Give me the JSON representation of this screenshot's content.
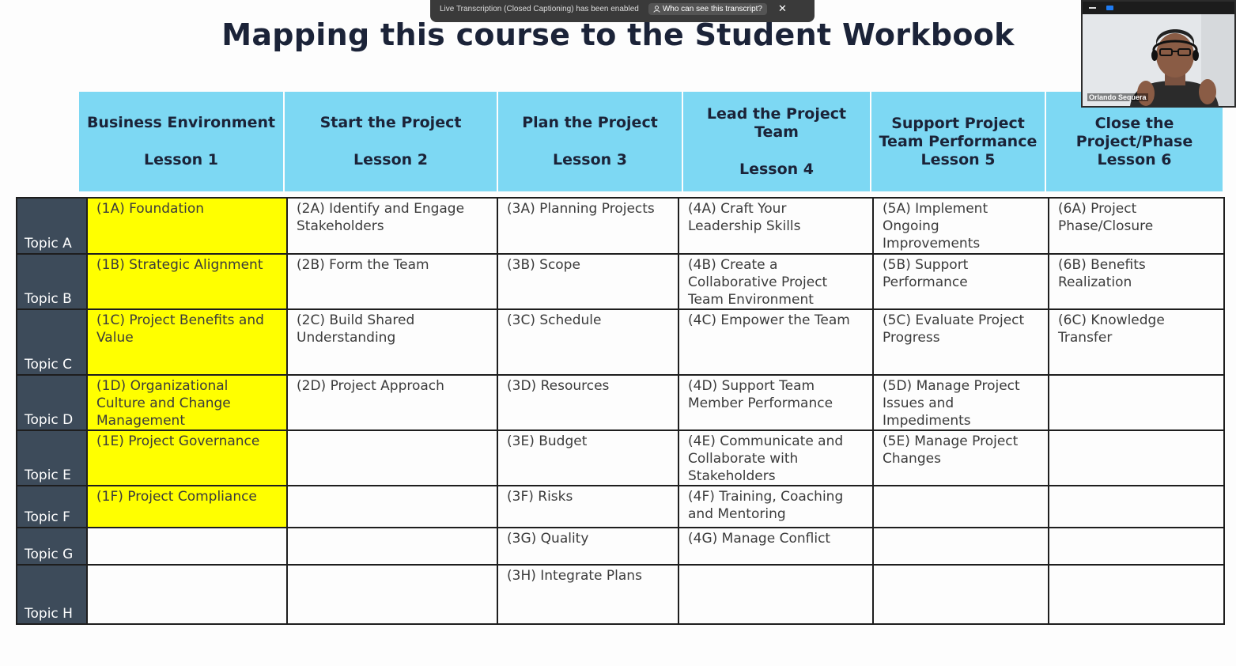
{
  "title": "Mapping this course to the Student Workbook",
  "banner": {
    "message": "Live Transcription (Closed Captioning) has been enabled",
    "who_label": "Who can see this transcript?",
    "close_label": "✕"
  },
  "video": {
    "participant_name": "Orlando Sequera"
  },
  "lessons": [
    {
      "name": "Business Environment",
      "lesson": "Lesson 1"
    },
    {
      "name": "Start the Project",
      "lesson": "Lesson 2"
    },
    {
      "name": "Plan the Project",
      "lesson": "Lesson 3"
    },
    {
      "name": "Lead the Project Team",
      "lesson": "Lesson 4"
    },
    {
      "name": "Support Project Team Performance",
      "lesson": "Lesson 5"
    },
    {
      "name": "Close the Project/Phase",
      "lesson": "Lesson 6"
    }
  ],
  "rows": [
    {
      "topic": "Topic A",
      "cells": [
        "(1A) Foundation",
        "(2A) Identify and Engage Stakeholders",
        "(3A) Planning Projects",
        "(4A) Craft Your Leadership Skills",
        "(5A) Implement Ongoing Improvements",
        "(6A) Project Phase/Closure"
      ]
    },
    {
      "topic": "Topic B",
      "cells": [
        "(1B) Strategic Alignment",
        "(2B) Form the Team",
        "(3B) Scope",
        "(4B) Create a Collaborative Project Team Environment",
        "(5B) Support Performance",
        "(6B) Benefits Realization"
      ]
    },
    {
      "topic": "Topic C",
      "cells": [
        "(1C) Project Benefits and Value",
        "(2C) Build Shared Understanding",
        "(3C) Schedule",
        "(4C) Empower the Team",
        "(5C) Evaluate Project Progress",
        "(6C) Knowledge Transfer"
      ]
    },
    {
      "topic": "Topic D",
      "cells": [
        "(1D) Organizational Culture and Change Management",
        "(2D) Project Approach",
        "(3D) Resources",
        "(4D) Support Team Member Performance",
        "(5D) Manage Project Issues and Impediments",
        ""
      ]
    },
    {
      "topic": "Topic E",
      "cells": [
        "(1E) Project Governance",
        "",
        "(3E) Budget",
        "(4E) Communicate and Collaborate with Stakeholders",
        "(5E) Manage Project Changes",
        ""
      ]
    },
    {
      "topic": "Topic F",
      "cells": [
        "(1F) Project Compliance",
        "",
        "(3F) Risks",
        "(4F) Training, Coaching and Mentoring",
        "",
        ""
      ]
    },
    {
      "topic": "Topic G",
      "cells": [
        "",
        "",
        "(3G) Quality",
        "(4G) Manage Conflict",
        "",
        ""
      ]
    },
    {
      "topic": "Topic H",
      "cells": [
        "",
        "",
        "(3H) Integrate Plans",
        "",
        "",
        ""
      ]
    }
  ],
  "colors": {
    "header_bg": "#7dd8f3",
    "highlight": "#ffff00",
    "topic_bg": "#3d4b5a",
    "title": "#1b2338"
  }
}
